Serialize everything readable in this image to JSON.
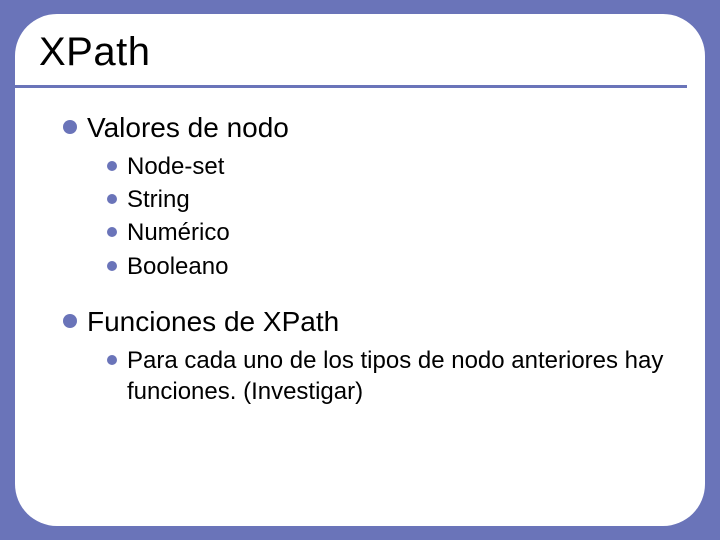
{
  "slide": {
    "title": "XPath",
    "sections": [
      {
        "heading": "Valores de nodo",
        "items": [
          "Node-set",
          "String",
          "Numérico",
          "Booleano"
        ]
      },
      {
        "heading": "Funciones de XPath",
        "items": [
          "Para cada uno de los tipos de nodo anteriores hay funciones.  (Investigar)"
        ]
      }
    ]
  }
}
